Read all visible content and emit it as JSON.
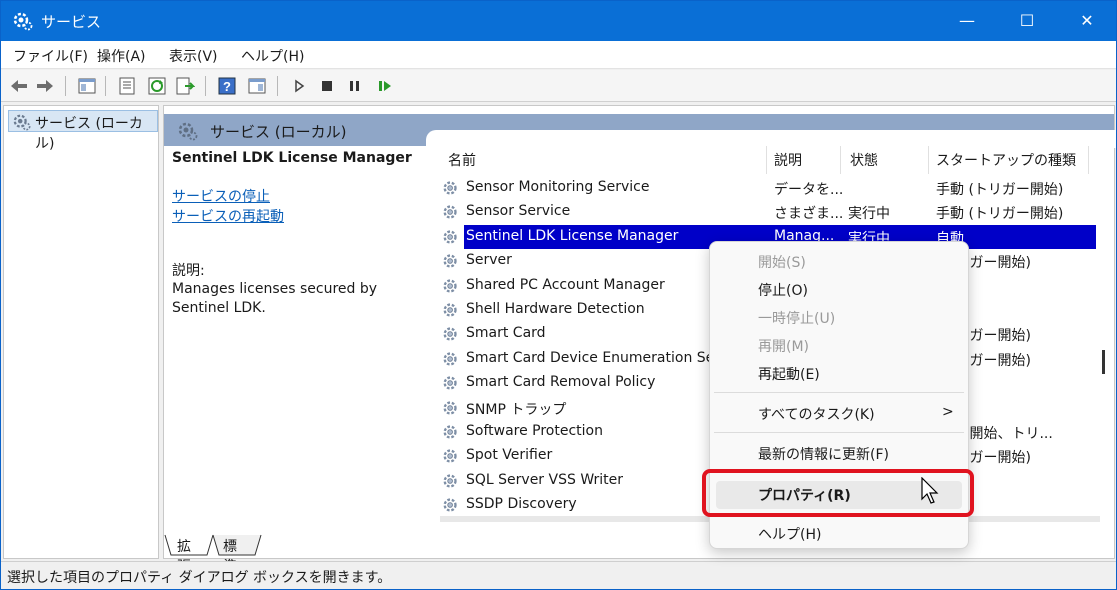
{
  "window": {
    "title": "サービス",
    "minimize": "—",
    "maximize": "☐",
    "close": "✕"
  },
  "menu": [
    "ファイル(F)",
    "操作(A)",
    "表示(V)",
    "ヘルプ(H)"
  ],
  "tree": {
    "item": "サービス (ローカル)"
  },
  "pane_header": "サービス (ローカル)",
  "details": {
    "service_name": "Sentinel LDK License Manager",
    "link_stop": "サービスの停止",
    "link_restart": "サービスの再起動",
    "desc_label": "説明:",
    "desc_text": "Manages licenses secured by Sentinel LDK."
  },
  "columns": [
    "名前",
    "説明",
    "状態",
    "スタートアップの種類"
  ],
  "rows": [
    {
      "name": "Sensor Monitoring Service",
      "desc": "データを...",
      "status": "",
      "startup": "手動 (トリガー開始)"
    },
    {
      "name": "Sensor Service",
      "desc": "さまざま...",
      "status": "実行中",
      "startup": "手動 (トリガー開始)"
    },
    {
      "name": "Sentinel LDK License Manager",
      "desc": "Manag...",
      "status": "実行中",
      "startup": "自動"
    },
    {
      "name": "Server",
      "desc": "",
      "status": "",
      "startup": "(トリガー開始)"
    },
    {
      "name": "Shared PC Account Manager",
      "desc": "",
      "status": "",
      "startup": ""
    },
    {
      "name": "Shell Hardware Detection",
      "desc": "",
      "status": "",
      "startup": ""
    },
    {
      "name": "Smart Card",
      "desc": "",
      "status": "",
      "startup": "(トリガー開始)"
    },
    {
      "name": "Smart Card Device Enumeration Serv",
      "desc": "",
      "status": "",
      "startup": "(トリガー開始)"
    },
    {
      "name": "Smart Card Removal Policy",
      "desc": "",
      "status": "",
      "startup": ""
    },
    {
      "name": "SNMP トラップ",
      "desc": "",
      "status": "",
      "startup": ""
    },
    {
      "name": "Software Protection",
      "desc": "",
      "status": "",
      "startup": "(遅延開始、トリ..."
    },
    {
      "name": "Spot Verifier",
      "desc": "",
      "status": "",
      "startup": "(トリガー開始)"
    },
    {
      "name": "SQL Server VSS Writer",
      "desc": "",
      "status": "",
      "startup": ""
    },
    {
      "name": "SSDP Discovery",
      "desc": "",
      "status": "",
      "startup": ""
    }
  ],
  "tabs": [
    "拡張",
    "標準"
  ],
  "status": "選択した項目のプロパティ ダイアログ ボックスを開きます。",
  "context_menu": {
    "start": "開始(S)",
    "stop": "停止(O)",
    "pause": "一時停止(U)",
    "resume": "再開(M)",
    "restart": "再起動(E)",
    "all_tasks": "すべてのタスク(K)",
    "refresh": "最新の情報に更新(F)",
    "properties": "プロパティ(R)",
    "help": "ヘルプ(H)",
    "submenu_arrow": ">"
  },
  "colors": {
    "titlebar": "#0a6fd6",
    "selection": "#0000c8",
    "highlight_box": "#e0131f"
  }
}
